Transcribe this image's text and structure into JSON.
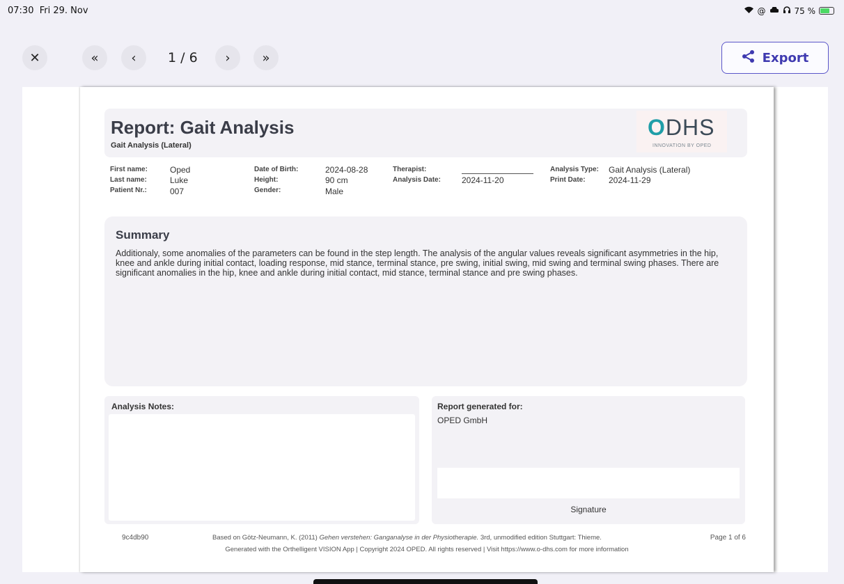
{
  "status_bar": {
    "time": "07:30",
    "date": "Fri 29. Nov",
    "battery_text": "75 %",
    "battery_level": 0.75
  },
  "toolbar": {
    "close_icon": "close-icon",
    "page_indicator": "1 / 6",
    "export_label": "Export",
    "accent_color": "#4b45c0"
  },
  "report": {
    "title": "Report: Gait Analysis",
    "subtitle": "Gait Analysis (Lateral)",
    "logo": {
      "brand": "DHS",
      "brand_o": "O",
      "tagline": "INNOVATION BY OPED"
    },
    "patient": {
      "first_name_label": "First name:",
      "first_name": "Oped",
      "last_name_label": "Last name:",
      "last_name": "Luke",
      "patient_nr_label": "Patient Nr.:",
      "patient_nr": "007",
      "dob_label": "Date of Birth:",
      "dob": "2024-08-28",
      "height_label": "Height:",
      "height": "90 cm",
      "gender_label": "Gender:",
      "gender": "Male",
      "therapist_label": "Therapist:",
      "analysis_date_label": "Analysis Date:",
      "analysis_date": "2024-11-20",
      "analysis_type_label": "Analysis Type:",
      "analysis_type": "Gait Analysis (Lateral)",
      "print_date_label": "Print Date:",
      "print_date": "2024-11-29"
    },
    "summary": {
      "title": "Summary",
      "text": "Additionaly, some anomalies of the parameters can be found in the step length. The analysis of the angular values reveals significant asymmetries in the hip, knee and ankle during initial contact, loading response, mid stance, terminal stance, pre swing, initial swing, mid swing and terminal swing phases. There are significant anomalies in the hip, knee and ankle during initial contact, mid stance, terminal stance and pre swing phases."
    },
    "notes_label": "Analysis Notes:",
    "generated_for_label": "Report generated for:",
    "generated_for": "OPED GmbH",
    "signature_label": "Signature",
    "footer": {
      "id": "9c4db90",
      "citation_pre": "Based on Götz-Neumann, K. (2011) ",
      "citation_title": "Gehen verstehen: Ganganalyse in der Physiotherapie.",
      "citation_post": " 3rd, unmodified edition Stuttgart: Thieme.",
      "page": "Page 1 of 6",
      "copyright": "Generated with the Orthelligent VISION App | Copyright 2024 OPED. All rights reserved | Visit https://www.o-dhs.com for more information"
    }
  }
}
